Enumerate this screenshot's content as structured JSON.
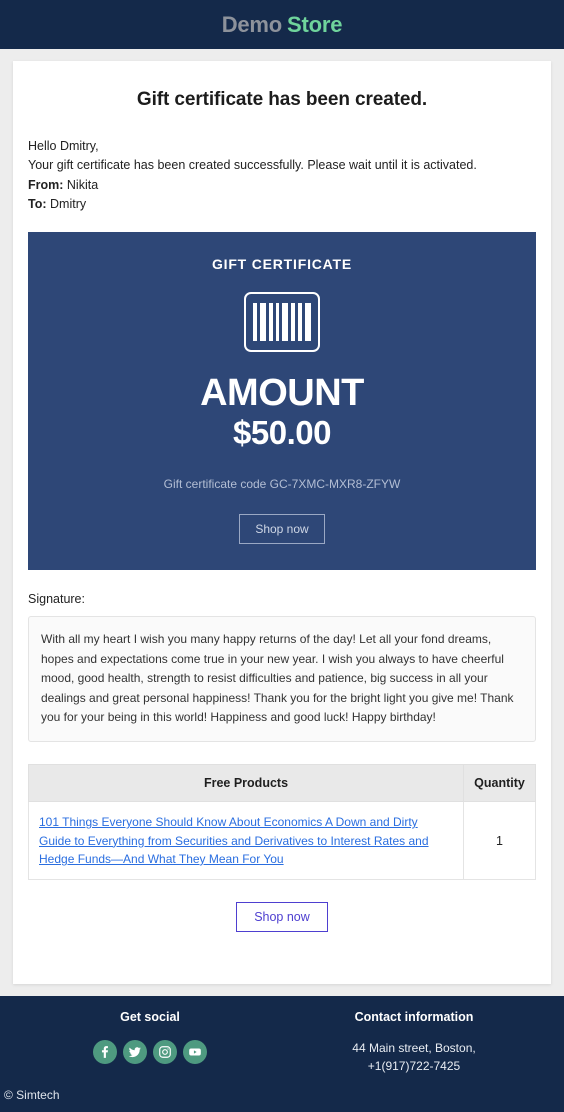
{
  "header": {
    "logo_first": "Demo",
    "logo_second": "Store",
    "bg_color": "#14294a",
    "logo_first_color": "#8d929b",
    "logo_second_color": "#6fd49c"
  },
  "document": {
    "title": "Gift certificate has been created.",
    "greeting": "Hello Dmitry,",
    "message": "Your gift certificate has been created successfully. Please wait until it is activated.",
    "from_label": "From:",
    "from_value": "Nikita",
    "to_label": "To:",
    "to_value": "Dmitry"
  },
  "gift_certificate": {
    "label": "GIFT CERTIFICATE",
    "amount_word": "AMOUNT",
    "amount_value": "$50.00",
    "code_text": "Gift certificate code GC-7XMC-MXR8-ZFYW",
    "shop_button": "Shop now",
    "bg_color": "#2e4777",
    "barcode_icon": "barcode-icon"
  },
  "signature": {
    "label": "Signature:",
    "text": "With all my heart I wish you many happy returns of the day! Let all your fond dreams, hopes and expectations come true in your new year. I wish you always to have cheerful mood, good health, strength to resist difficulties and patience, big success in all your dealings and great personal happiness! Thank you for the bright light you give me! Thank you for your being in this world! Happiness and good luck! Happy birthday!"
  },
  "products_table": {
    "columns": [
      "Free Products",
      "Quantity"
    ],
    "rows": [
      {
        "product": "101 Things Everyone Should Know About Economics A Down and Dirty Guide to Everything from Securities and Derivatives to Interest Rates and Hedge Funds—And What They Mean For You",
        "quantity": "1"
      }
    ],
    "link_color": "#2a6ee0"
  },
  "bottom_action": {
    "shop_button": "Shop now",
    "accent_color": "#4e3fd0"
  },
  "footer": {
    "social_heading": "Get social",
    "social_icons": [
      "facebook-icon",
      "twitter-icon",
      "instagram-icon",
      "youtube-icon"
    ],
    "social_icon_color": "#4e9a80",
    "contact_heading": "Contact information",
    "contact_address": "44 Main street, Boston,",
    "contact_phone": "+1(917)722-7425",
    "copyright": "© Simtech",
    "bg_color": "#14294a"
  }
}
